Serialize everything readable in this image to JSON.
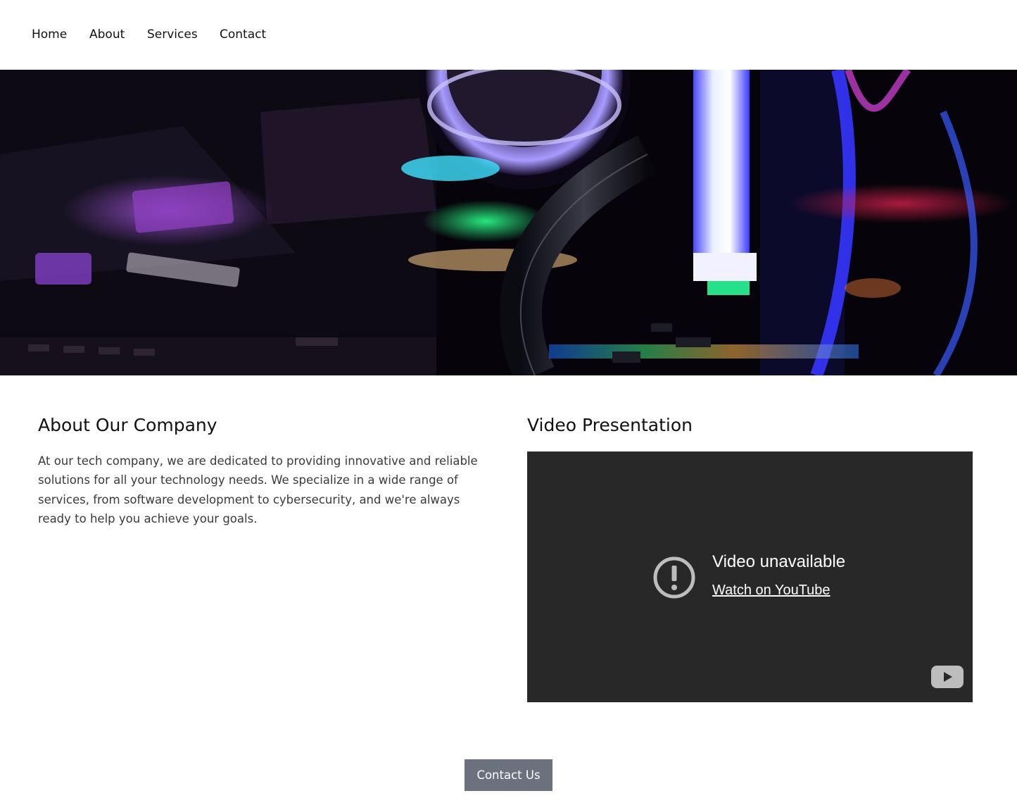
{
  "nav": {
    "items": [
      {
        "label": "Home"
      },
      {
        "label": "About"
      },
      {
        "label": "Services"
      },
      {
        "label": "Contact"
      }
    ]
  },
  "hero": {
    "image": "computer-hardware-rgb-lighting"
  },
  "about": {
    "title": "About Our Company",
    "text": "At our tech company, we are dedicated to providing innovative and reliable solutions for all your technology needs. We specialize in a wide range of services, from software development to cybersecurity, and we're always ready to help you achieve your goals."
  },
  "video": {
    "title": "Video Presentation",
    "unavailable_text": "Video unavailable",
    "watch_link": "Watch on YouTube",
    "icons": [
      "alert-circle-icon",
      "youtube-play-icon"
    ]
  },
  "cta": {
    "label": "Contact Us"
  },
  "colors": {
    "cta_background": "#6b727e",
    "video_background": "#282828",
    "body_text": "#3a3a3a"
  }
}
